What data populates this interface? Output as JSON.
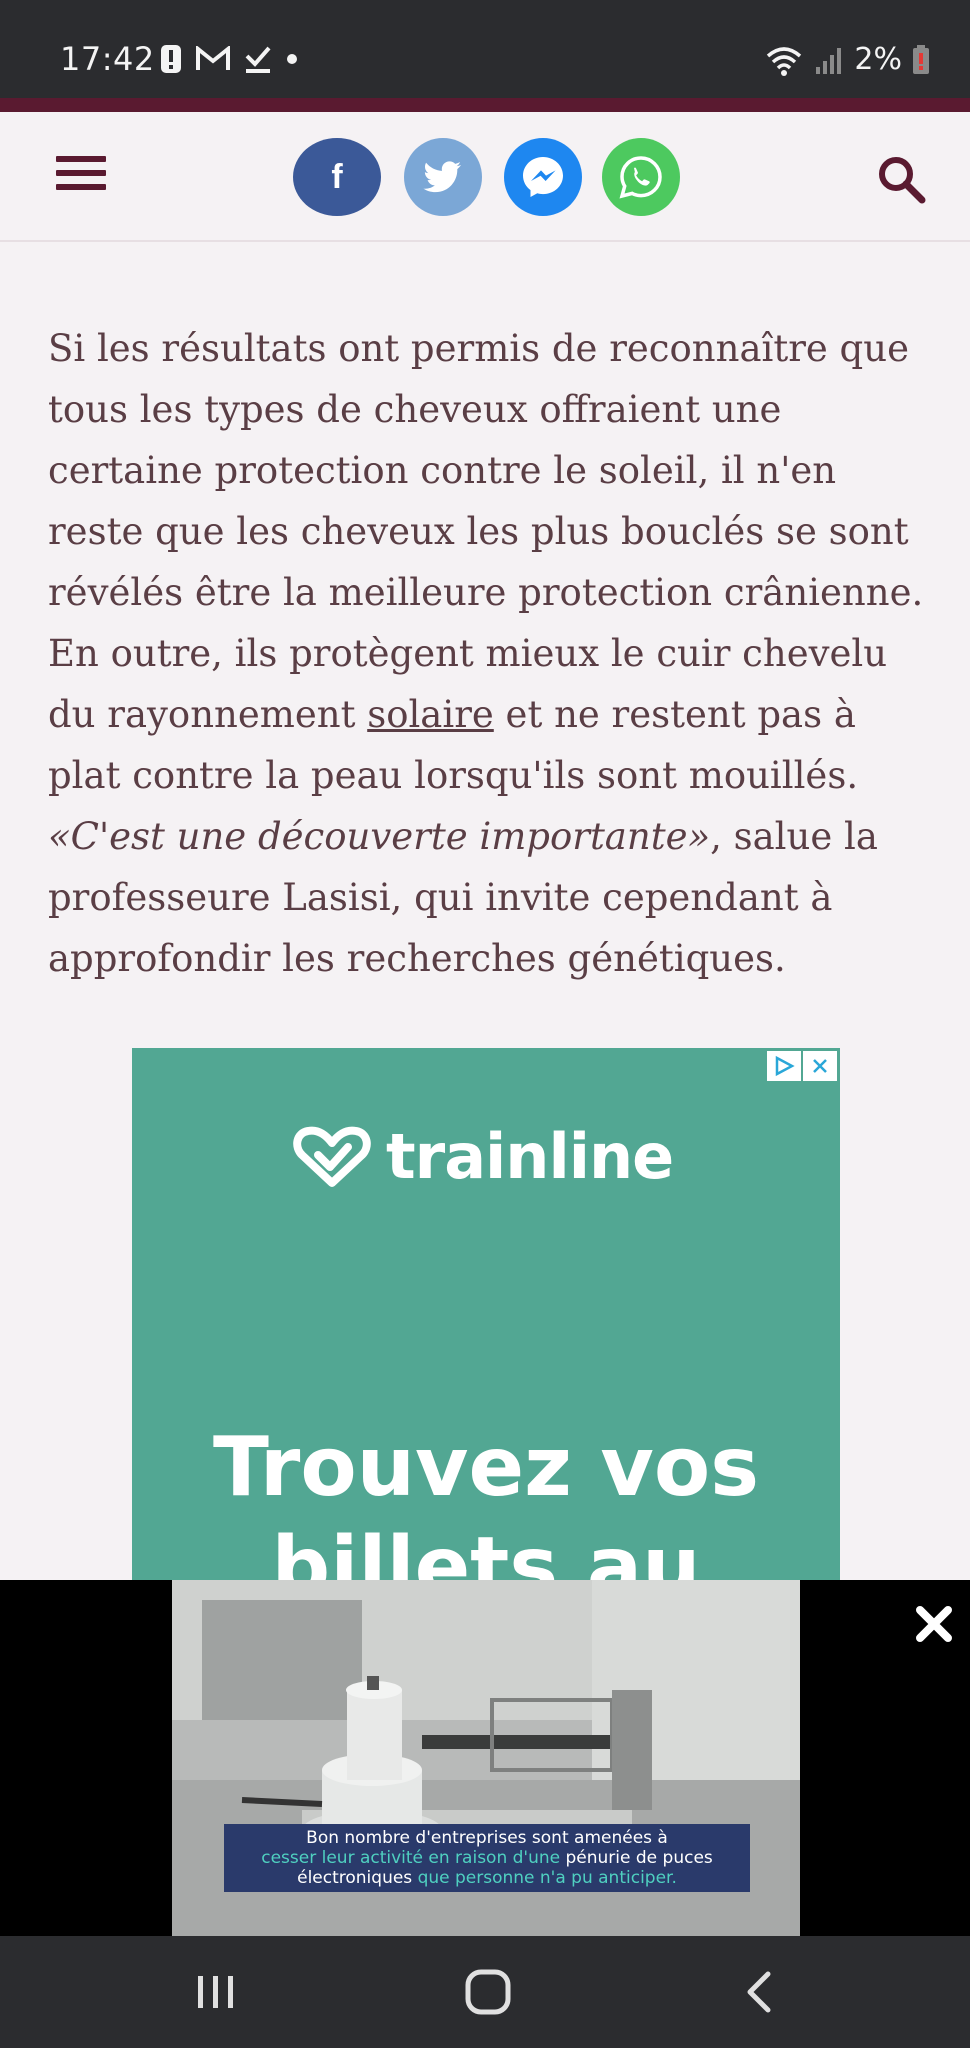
{
  "status_bar": {
    "time": "17:42",
    "battery": "2%",
    "icons": [
      "alert-icon",
      "gmail-icon",
      "check-download-icon",
      "dot-icon",
      "wifi-icon",
      "signal-icon",
      "battery-icon"
    ]
  },
  "header": {
    "share_buttons": [
      {
        "network": "facebook",
        "glyph": "f",
        "color": "#3b5998"
      },
      {
        "network": "twitter",
        "color": "#7ba7d6"
      },
      {
        "network": "messenger",
        "color": "#1e87f0"
      },
      {
        "network": "whatsapp",
        "color": "#4dc95f"
      }
    ],
    "accent_color": "#5a1a30"
  },
  "article": {
    "text_before_link": "Si les résultats ont permis de reconnaître que tous les types de cheveux offraient une certaine protection contre le soleil, il n'en reste que les cheveux les plus bouclés se sont révélés être la meilleure protection crânienne. En outre, ils protègent mieux le cuir chevelu du rayonnement ",
    "link_text": "solaire",
    "text_after_link": " et ne restent pas à plat contre la peau lorsqu'ils sont mouillés. ",
    "quote": "«C'est une découverte importante»",
    "text_after_quote": ", salue la professeure Lasisi, qui invite cependant à approfondir les recherches génétiques."
  },
  "ad": {
    "brand": "trainline",
    "headline": "Trouvez vos billets au",
    "background_color": "#52a793"
  },
  "video": {
    "caption_line1": "Bon nombre d'entreprises sont amenées à",
    "caption_line2_a": "cesser leur activité en raison d'une ",
    "caption_line2_b": "pénurie de puces",
    "caption_line3_a": "électroniques ",
    "caption_line3_b": "que personne n'a pu anticiper."
  },
  "nav_bar": {
    "buttons": [
      "recent-apps",
      "home",
      "back"
    ]
  }
}
